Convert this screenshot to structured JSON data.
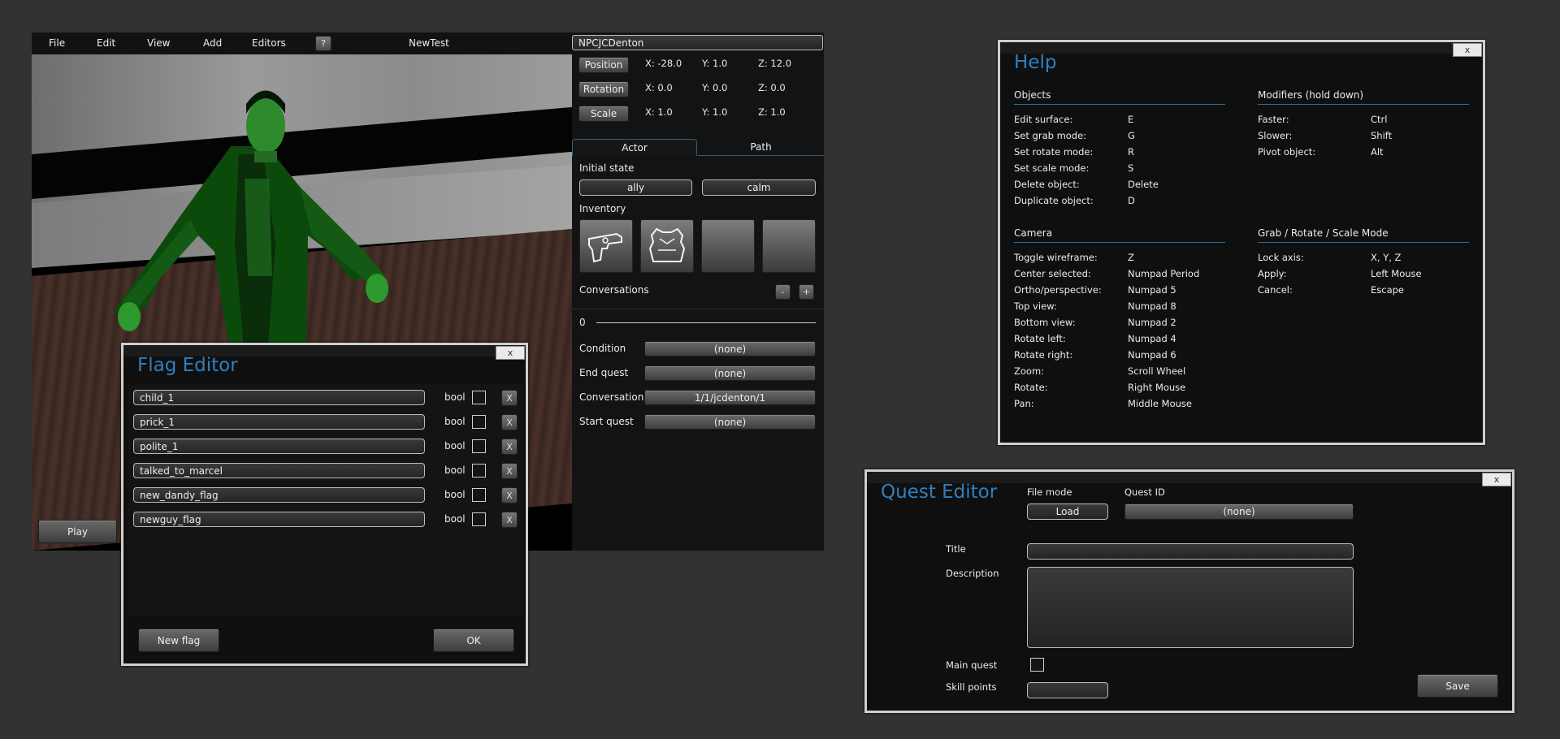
{
  "menubar": {
    "file": "File",
    "edit": "Edit",
    "view": "View",
    "add": "Add",
    "editors": "Editors",
    "help": "?",
    "scene_name": "NewTest"
  },
  "viewport": {
    "play_label": "Play"
  },
  "props": {
    "object_name": "NPCJCDenton",
    "position": {
      "label": "Position",
      "x": "X: -28.0",
      "y": "Y: 1.0",
      "z": "Z: 12.0"
    },
    "rotation": {
      "label": "Rotation",
      "x": "X: 0.0",
      "y": "Y: 0.0",
      "z": "Z: 0.0"
    },
    "scale": {
      "label": "Scale",
      "x": "X: 1.0",
      "y": "Y: 1.0",
      "z": "Z: 1.0"
    },
    "tabs": [
      "Actor",
      "Path"
    ],
    "initial_state_label": "Initial state",
    "initial_state": [
      "ally",
      "calm"
    ],
    "inventory_label": "Inventory",
    "inventory_icons": [
      "pistol-icon",
      "armor-vest-icon",
      "",
      ""
    ],
    "conversations_label": "Conversations",
    "minus": "-",
    "plus": "+",
    "conversation_index": "0",
    "rows": [
      {
        "label": "Condition",
        "value": "(none)"
      },
      {
        "label": "End quest",
        "value": "(none)"
      },
      {
        "label": "Conversation",
        "value": "1/1/jcdenton/1"
      },
      {
        "label": "Start quest",
        "value": "(none)"
      }
    ]
  },
  "flag_editor": {
    "title": "Flag Editor",
    "close": "x",
    "flags": [
      {
        "name": "child_1",
        "type": "bool",
        "remove": "X"
      },
      {
        "name": "prick_1",
        "type": "bool",
        "remove": "X"
      },
      {
        "name": "polite_1",
        "type": "bool",
        "remove": "X"
      },
      {
        "name": "talked_to_marcel",
        "type": "bool",
        "remove": "X"
      },
      {
        "name": "new_dandy_flag",
        "type": "bool",
        "remove": "X"
      },
      {
        "name": "newguy_flag",
        "type": "bool",
        "remove": "X"
      }
    ],
    "new_flag": "New flag",
    "ok": "OK"
  },
  "help": {
    "title": "Help",
    "close": "x",
    "sections": {
      "objects": {
        "title": "Objects",
        "rows": [
          {
            "action": "Edit surface:",
            "key": "E"
          },
          {
            "action": "Set grab mode:",
            "key": "G"
          },
          {
            "action": "Set rotate mode:",
            "key": "R"
          },
          {
            "action": "Set scale mode:",
            "key": "S"
          },
          {
            "action": "Delete object:",
            "key": "Delete"
          },
          {
            "action": "Duplicate object:",
            "key": "D"
          }
        ]
      },
      "modifiers": {
        "title": "Modifiers (hold down)",
        "rows": [
          {
            "action": "Faster:",
            "key": "Ctrl"
          },
          {
            "action": "Slower:",
            "key": "Shift"
          },
          {
            "action": "Pivot object:",
            "key": "Alt"
          }
        ]
      },
      "camera": {
        "title": "Camera",
        "rows": [
          {
            "action": "Toggle wireframe:",
            "key": "Z"
          },
          {
            "action": "Center selected:",
            "key": "Numpad Period"
          },
          {
            "action": "Ortho/perspective:",
            "key": "Numpad 5"
          },
          {
            "action": "Top view:",
            "key": "Numpad 8"
          },
          {
            "action": "Bottom view:",
            "key": "Numpad 2"
          },
          {
            "action": "Rotate left:",
            "key": "Numpad 4"
          },
          {
            "action": "Rotate right:",
            "key": "Numpad 6"
          },
          {
            "action": "Zoom:",
            "key": "Scroll Wheel"
          },
          {
            "action": "Rotate:",
            "key": "Right Mouse"
          },
          {
            "action": "Pan:",
            "key": "Middle Mouse"
          }
        ]
      },
      "grab": {
        "title": "Grab / Rotate / Scale Mode",
        "rows": [
          {
            "action": "Lock axis:",
            "key": "X, Y, Z"
          },
          {
            "action": "Apply:",
            "key": "Left Mouse"
          },
          {
            "action": "Cancel:",
            "key": "Escape"
          }
        ]
      }
    }
  },
  "quest_editor": {
    "title": "Quest Editor",
    "close": "x",
    "file_mode_label": "File mode",
    "file_mode_value": "Load",
    "quest_id_label": "Quest ID",
    "quest_id_value": "(none)",
    "title_label": "Title",
    "title_value": "",
    "description_label": "Description",
    "description_value": "",
    "main_quest_label": "Main quest",
    "skill_points_label": "Skill points",
    "skill_points_value": "",
    "save": "Save"
  }
}
